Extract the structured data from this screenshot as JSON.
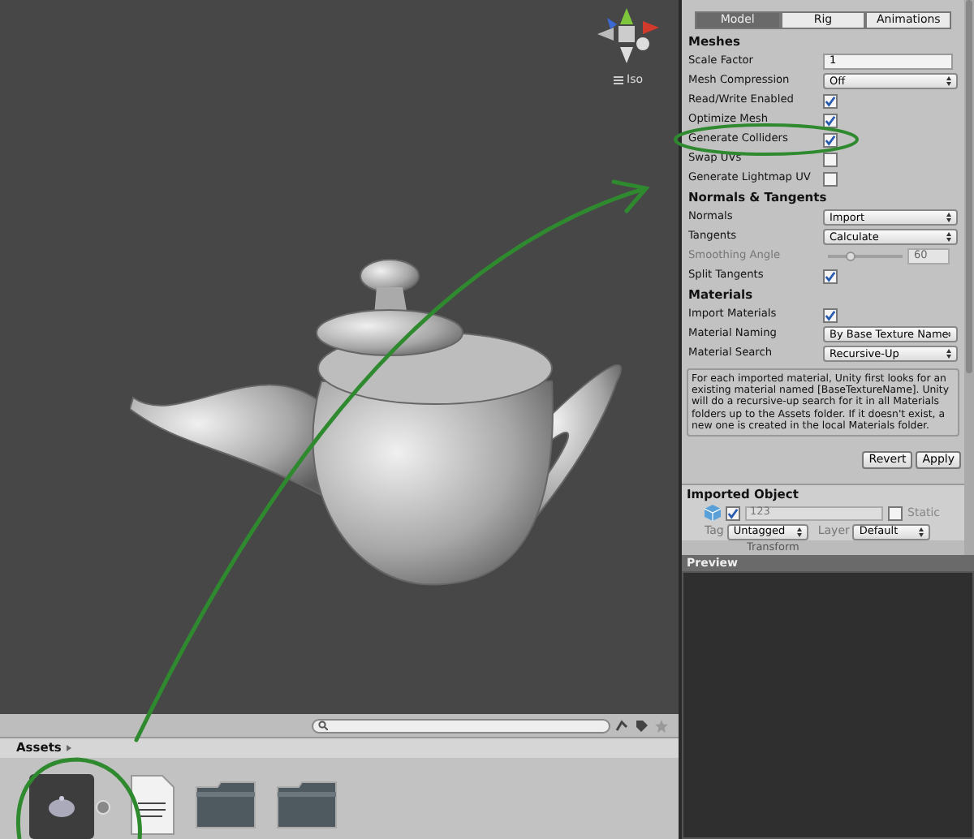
{
  "scene": {
    "view_mode": "Iso"
  },
  "inspector": {
    "tabs": [
      {
        "label": "Model",
        "selected": true
      },
      {
        "label": "Rig",
        "selected": false
      },
      {
        "label": "Animations",
        "selected": false
      }
    ],
    "sections": [
      {
        "title": "Meshes",
        "rows": [
          {
            "kind": "text",
            "label": "Scale Factor",
            "value": "1"
          },
          {
            "kind": "dropdown",
            "label": "Mesh Compression",
            "value": "Off"
          },
          {
            "kind": "checkbox",
            "label": "Read/Write Enabled",
            "checked": true
          },
          {
            "kind": "checkbox",
            "label": "Optimize Mesh",
            "checked": true
          },
          {
            "kind": "checkbox",
            "label": "Generate Colliders",
            "checked": true
          },
          {
            "kind": "checkbox",
            "label": "Swap UVs",
            "checked": false
          },
          {
            "kind": "checkbox",
            "label": "Generate Lightmap UV",
            "checked": false
          }
        ]
      },
      {
        "title": "Normals & Tangents",
        "rows": [
          {
            "kind": "dropdown",
            "label": "Normals",
            "value": "Import"
          },
          {
            "kind": "dropdown",
            "label": "Tangents",
            "value": "Calculate"
          },
          {
            "kind": "slider",
            "label": "Smoothing Angle",
            "disabled": true,
            "level": 0.3,
            "value": "60"
          },
          {
            "kind": "checkbox",
            "label": "Split Tangents",
            "checked": true
          }
        ]
      },
      {
        "title": "Materials",
        "rows": [
          {
            "kind": "checkbox",
            "label": "Import Materials",
            "checked": true
          },
          {
            "kind": "dropdown",
            "label": "Material Naming",
            "value": "By Base Texture Name"
          },
          {
            "kind": "dropdown",
            "label": "Material Search",
            "value": "Recursive-Up"
          },
          {
            "kind": "note",
            "text": "For each imported material, Unity first looks for an existing material named [BaseTextureName]. Unity will do a recursive-up search for it in all Materials folders up to the Assets folder. If it doesn't exist, a new one is created in the local Materials folder."
          }
        ]
      }
    ],
    "buttons": [
      "Revert",
      "Apply"
    ]
  },
  "imported_object": {
    "title": "Imported Object",
    "active": true,
    "name": "123",
    "static_label": "Static",
    "static": false,
    "tag_label": "Tag",
    "tag": "Untagged",
    "layer_label": "Layer",
    "layer": "Default",
    "component": "Transform"
  },
  "preview": {
    "title": "Preview"
  },
  "project": {
    "breadcrumb": "Assets",
    "assets": [
      {
        "kind": "model",
        "selected": true
      },
      {
        "kind": "document",
        "selected": false
      },
      {
        "kind": "folder",
        "selected": false
      },
      {
        "kind": "folder",
        "selected": false
      }
    ]
  }
}
